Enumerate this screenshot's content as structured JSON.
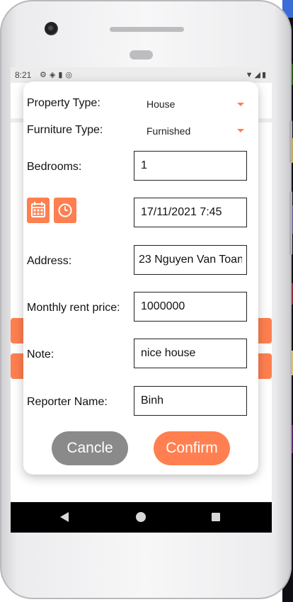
{
  "status_bar": {
    "time": "8:21"
  },
  "dialog": {
    "property_type": {
      "label": "Property Type:",
      "value": "House"
    },
    "furniture_type": {
      "label": "Furniture Type:",
      "value": "Furnished"
    },
    "bedrooms": {
      "label": "Bedrooms:",
      "value": "1"
    },
    "datetime": {
      "value": "17/11/2021 7:45"
    },
    "address": {
      "label": "Address:",
      "value": "23 Nguyen Van Toan"
    },
    "rent": {
      "label": "Monthly rent price:",
      "value": "1000000"
    },
    "note": {
      "label": "Note:",
      "value": "nice house"
    },
    "reporter": {
      "label": "Reporter Name:",
      "value": "Binh"
    },
    "cancel_label": "Cancle",
    "confirm_label": "Confirm"
  },
  "colors": {
    "accent": "#ff7f50",
    "cancel": "#8a8a8a"
  },
  "icons": [
    "calendar-icon",
    "clock-icon",
    "back-icon",
    "home-icon",
    "recents-icon",
    "wifi-icon",
    "battery-icon",
    "settings-icon"
  ]
}
